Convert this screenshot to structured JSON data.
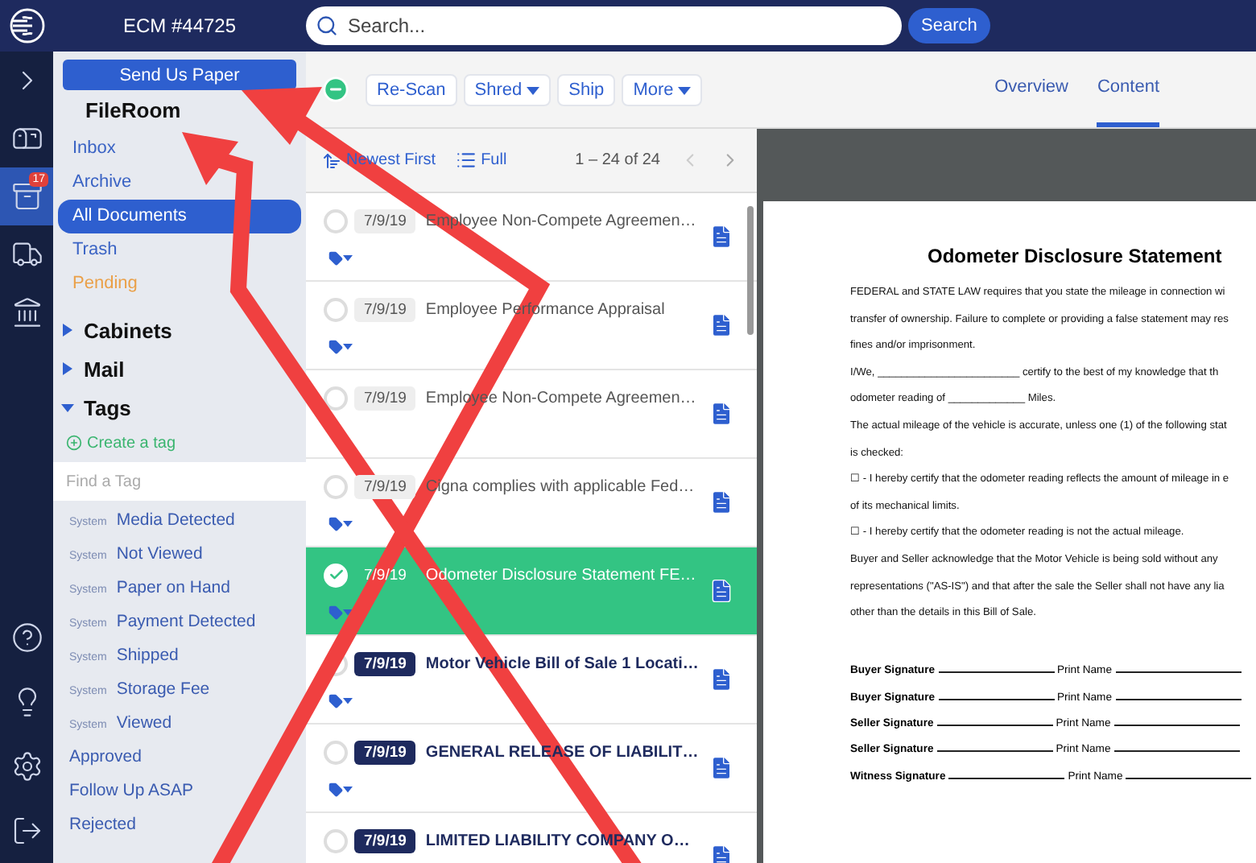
{
  "top_bar": {
    "title": "ECM #44725",
    "search": {
      "placeholder": "Search..."
    },
    "search_button": "Search"
  },
  "rail": {
    "items": [
      {
        "kind": "chevron",
        "selected": false
      },
      {
        "kind": "mailbox",
        "selected": false
      },
      {
        "kind": "cabinet",
        "selected": true,
        "badge": "17"
      },
      {
        "kind": "truck",
        "selected": false
      },
      {
        "kind": "bank",
        "selected": false
      }
    ],
    "bottom": [
      {
        "kind": "help"
      },
      {
        "kind": "bulb"
      },
      {
        "kind": "gear"
      },
      {
        "kind": "logout"
      }
    ]
  },
  "sidebar": {
    "send_button": "Send Us Paper",
    "heading": "FileRoom",
    "nav": [
      {
        "label": "Inbox",
        "selected": false,
        "color": "#3a63c4"
      },
      {
        "label": "Archive",
        "selected": false,
        "color": "#3a63c4"
      },
      {
        "label": "All Documents",
        "selected": true,
        "color": "#3a63c4"
      },
      {
        "label": "Trash",
        "selected": false,
        "color": "#3a63c4"
      },
      {
        "label": "Pending",
        "selected": false,
        "color": "#eaa048"
      }
    ],
    "sections": [
      {
        "label": "Cabinets",
        "expanded": false
      },
      {
        "label": "Mail",
        "expanded": false
      },
      {
        "label": "Tags",
        "expanded": true
      }
    ],
    "create_tag": "Create a tag",
    "find_tag": {
      "placeholder": "Find a Tag"
    },
    "tags": [
      {
        "prefix": "System",
        "label": "Media Detected"
      },
      {
        "prefix": "System",
        "label": "Not Viewed"
      },
      {
        "prefix": "System",
        "label": "Paper on Hand"
      },
      {
        "prefix": "System",
        "label": "Payment Detected"
      },
      {
        "prefix": "System",
        "label": "Shipped"
      },
      {
        "prefix": "System",
        "label": "Storage Fee"
      },
      {
        "prefix": "System",
        "label": "Viewed"
      },
      {
        "label": "Approved"
      },
      {
        "label": "Follow Up ASAP"
      },
      {
        "label": "Rejected"
      }
    ]
  },
  "toolbar": {
    "buttons": [
      {
        "label": "Re-Scan",
        "caret": false
      },
      {
        "label": "Shred",
        "caret": true
      },
      {
        "label": "Ship",
        "caret": false
      },
      {
        "label": "More",
        "caret": true
      }
    ],
    "tabs": [
      {
        "label": "Overview",
        "selected": false
      },
      {
        "label": "Content",
        "selected": true
      }
    ]
  },
  "list": {
    "sort": "Newest First",
    "view": "Full",
    "range": "1 – 24 of 24",
    "rows": [
      {
        "date": "7/9/19",
        "title": "Employee Non-Compete Agreemen…",
        "unread": false,
        "selected": false,
        "tagged": true
      },
      {
        "date": "7/9/19",
        "title": "Employee Performance Appraisal",
        "unread": false,
        "selected": false,
        "tagged": true
      },
      {
        "date": "7/9/19",
        "title": "Employee Non-Compete Agreemen…",
        "unread": false,
        "selected": false,
        "tagged": false
      },
      {
        "date": "7/9/19",
        "title": "Cigna complies with applicable Fed…",
        "unread": false,
        "selected": false,
        "tagged": true
      },
      {
        "date": "7/9/19",
        "title": "Odometer Disclosure Statement FE…",
        "unread": false,
        "selected": true,
        "tagged": true
      },
      {
        "date": "7/9/19",
        "title": "Motor Vehicle Bill of Sale 1 Locati…",
        "unread": true,
        "selected": false,
        "tagged": true
      },
      {
        "date": "7/9/19",
        "title": "GENERAL RELEASE OF LIABILIT…",
        "unread": true,
        "selected": false,
        "tagged": true
      },
      {
        "date": "7/9/19",
        "title": "LIMITED LIABILITY COMPANY O…",
        "unread": true,
        "selected": false
      }
    ]
  },
  "document": {
    "title": "Odometer Disclosure Statement",
    "lines": [
      "FEDERAL and STATE LAW requires that you state the mileage in connection wi",
      "transfer of ownership. Failure to complete or providing a false statement may res",
      "fines and/or imprisonment.",
      "I/We, ________________________ certify to the best of my knowledge that th",
      "odometer reading of _____________ Miles.",
      "The actual mileage of the vehicle is accurate, unless one (1) of the following stat",
      "is checked:",
      "☐ - I hereby certify that the odometer reading reflects the amount of mileage in e",
      "of its mechanical limits.",
      "☐ - I hereby certify that the odometer reading is not the actual mileage.",
      "Buyer and Seller acknowledge that the Motor Vehicle is being sold without any",
      "representations (\"AS-IS\") and that after the sale the Seller shall not have any lia",
      "other than the details in this Bill of Sale."
    ],
    "signatures": [
      {
        "label": "Buyer Signature",
        "print": "Print Name"
      },
      {
        "label": "Buyer Signature",
        "print": "Print Name"
      },
      {
        "label": "Seller Signature",
        "print": "Print Name"
      },
      {
        "label": "Seller Signature",
        "print": "Print Name"
      },
      {
        "label": "Witness Signature",
        "print": "Print Name"
      }
    ]
  }
}
